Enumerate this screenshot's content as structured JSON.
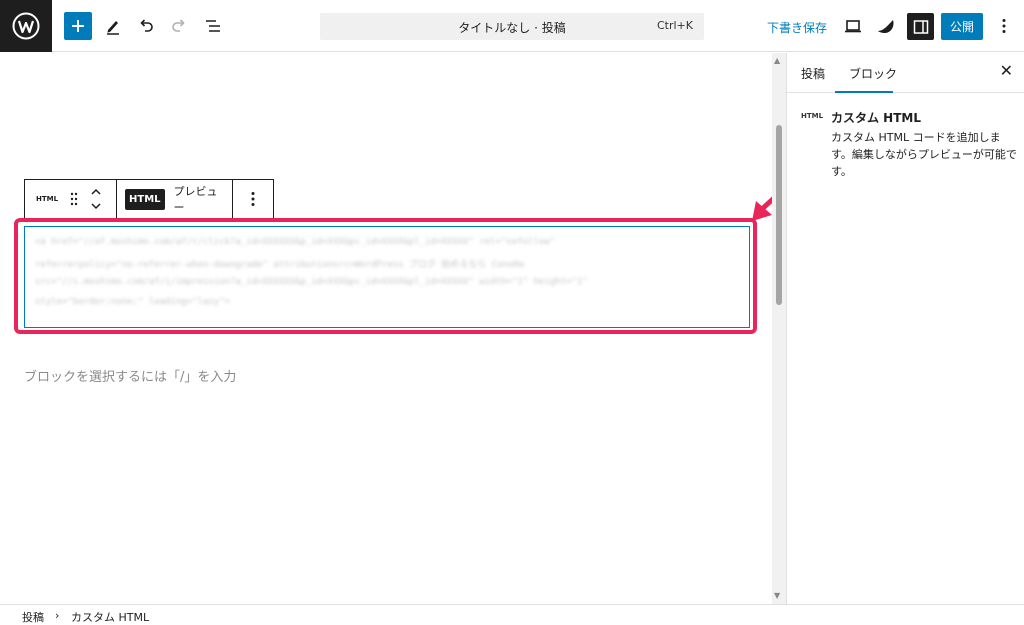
{
  "topbar": {
    "document_title": "タイトルなし · 投稿",
    "shortcut": "Ctrl+K",
    "save_draft": "下書き保存",
    "publish": "公開"
  },
  "block_toolbar": {
    "type_icon": "HTML",
    "html_tab": "HTML",
    "preview_tab": "プレビュー"
  },
  "editor": {
    "code_lines": [
      "<a href=\"//af.moshimo.com/af/c/click?a_id=XXXXXX&p_id=XXX&pc_id=XXXX&pl_id=XXXXX\" rel=\"nofollow\"",
      "referrerpolicy=\"no-referrer-when-downgrade\" attributionsrc>WordPress ブログ 始めるなら ConoHa",
      "src=\"//i.moshimo.com/af/i/impression?a_id=XXXXXX&p_id=XXX&pc_id=XXXX&pl_id=XXXXX\" width=\"1\" height=\"1\"",
      "style=\"border:none;\" loading=\"lazy\">"
    ],
    "placeholder": "ブロックを選択するには「/」を入力"
  },
  "sidebar": {
    "tabs": [
      "投稿",
      "ブロック"
    ],
    "block_icon": "HTML",
    "block_name": "カスタム HTML",
    "block_description": "カスタム HTML コードを追加します。編集しながらプレビューが可能です。"
  },
  "breadcrumb": {
    "items": [
      "投稿",
      "カスタム HTML"
    ],
    "separator": "›"
  },
  "colors": {
    "accent": "#007cba",
    "highlight": "#e8265a",
    "dark": "#1e1e1e"
  }
}
